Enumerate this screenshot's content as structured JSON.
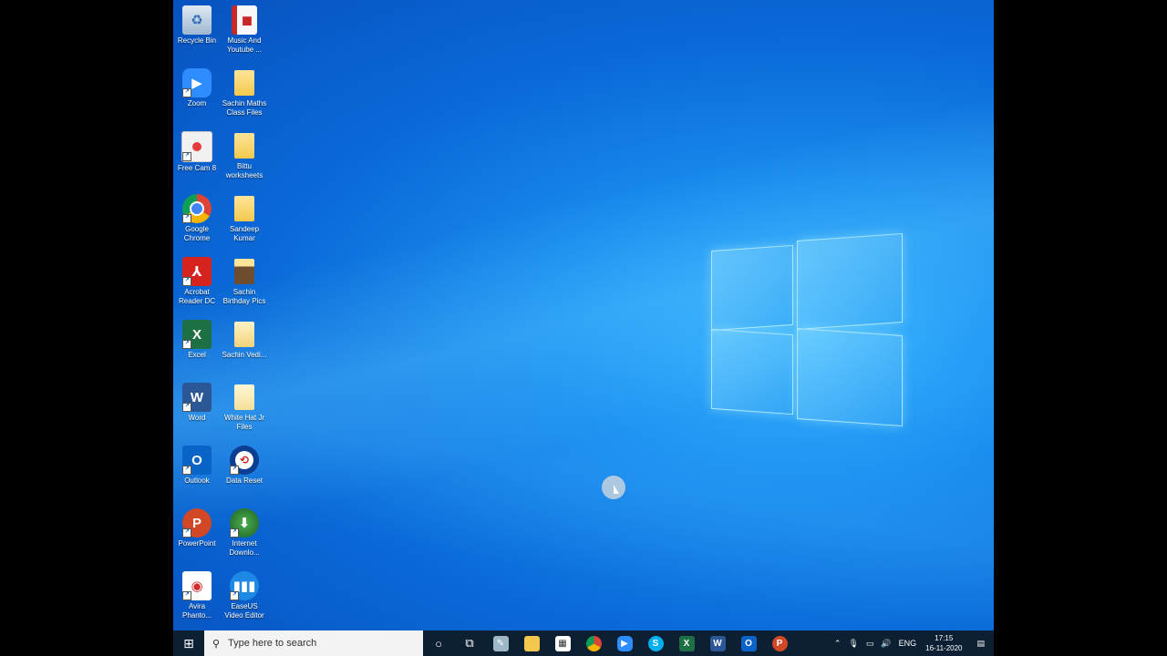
{
  "desktop": {
    "icons": [
      {
        "label": "Recycle Bin",
        "icon": "recycle-bin-icon"
      },
      {
        "label": "Music And Youtube ...",
        "icon": "file-icon"
      },
      {
        "label": "Zoom",
        "icon": "zoom-icon"
      },
      {
        "label": "Sachin Maths Class Files",
        "icon": "folder-icon"
      },
      {
        "label": "Free Cam 8",
        "icon": "freecam-icon"
      },
      {
        "label": "Bittu worksheets",
        "icon": "folder-icon"
      },
      {
        "label": "Google Chrome",
        "icon": "chrome-icon"
      },
      {
        "label": "Sandeep Kumar",
        "icon": "folder-icon"
      },
      {
        "label": "Acrobat Reader DC",
        "icon": "acrobat-icon"
      },
      {
        "label": "Sachin Birthday Pics",
        "icon": "folder-icon"
      },
      {
        "label": "Excel",
        "icon": "excel-icon"
      },
      {
        "label": "Sachin Vedi...",
        "icon": "folder-icon"
      },
      {
        "label": "Word",
        "icon": "word-icon"
      },
      {
        "label": "White Hat Jr Files",
        "icon": "folder-icon"
      },
      {
        "label": "Outlook",
        "icon": "outlook-icon"
      },
      {
        "label": "Data Reset",
        "icon": "data-reset-icon"
      },
      {
        "label": "PowerPoint",
        "icon": "powerpoint-icon"
      },
      {
        "label": "Internet Downlo...",
        "icon": "idm-icon"
      },
      {
        "label": "Avira Phanto...",
        "icon": "avira-icon"
      },
      {
        "label": "EaseUS Video Editor",
        "icon": "easeus-icon"
      }
    ]
  },
  "taskbar": {
    "search_placeholder": "Type here to search",
    "pinned": [
      "cortana-icon",
      "task-view-icon",
      "notes-icon",
      "file-explorer-icon",
      "store-icon",
      "chrome-icon",
      "zoom-icon",
      "skype-icon",
      "excel-icon",
      "word-icon",
      "outlook-icon",
      "powerpoint-icon"
    ],
    "language": "ENG",
    "time": "17:15",
    "date": "16-11-2020"
  }
}
